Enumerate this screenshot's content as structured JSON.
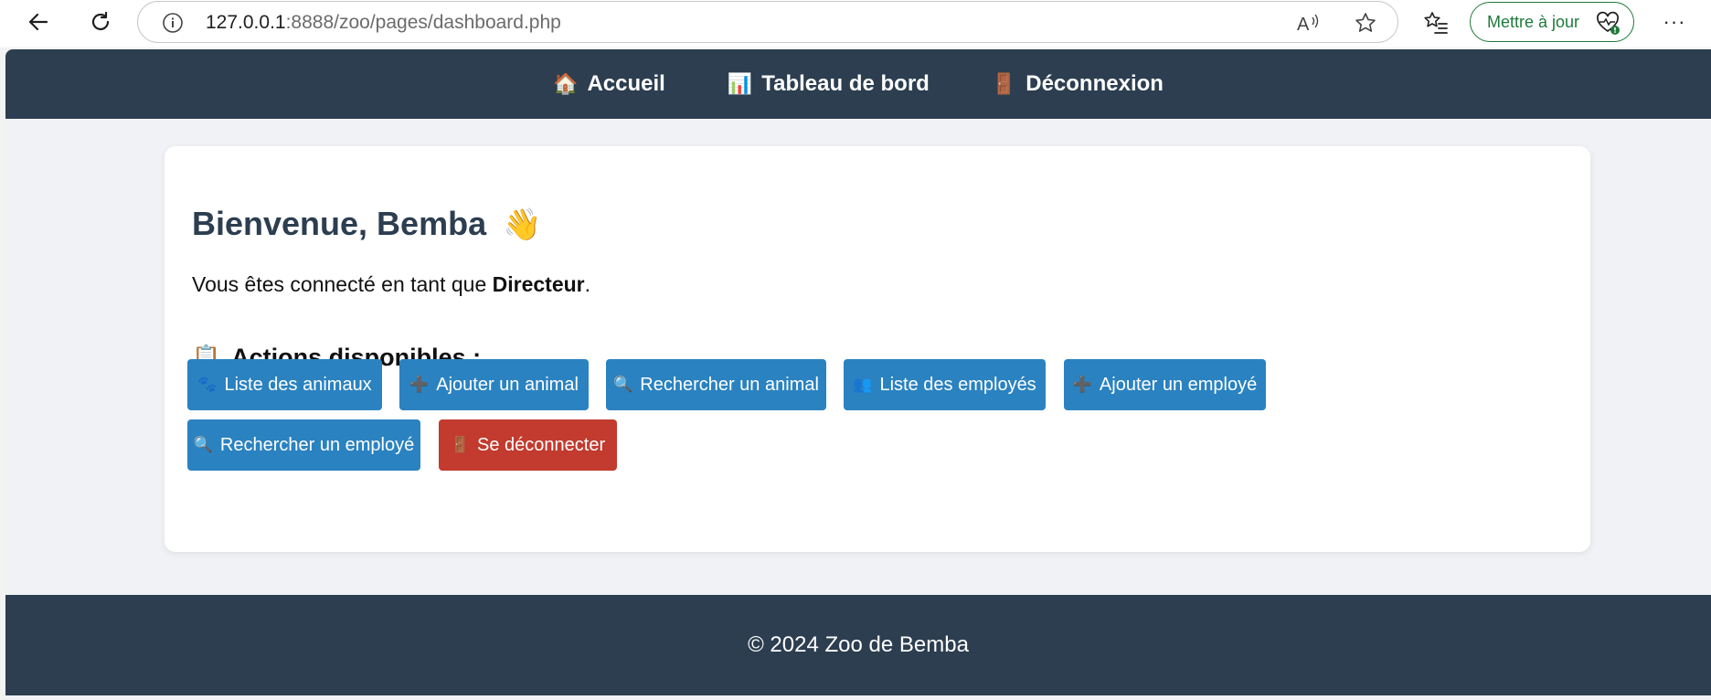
{
  "browser": {
    "url_host": "127.0.0.1",
    "url_rest": ":8888/zoo/pages/dashboard.php",
    "update_label": "Mettre à jour"
  },
  "nav": {
    "items": [
      {
        "icon": "🏠",
        "label": "Accueil"
      },
      {
        "icon": "📊",
        "label": "Tableau de bord"
      },
      {
        "icon": "🚪",
        "label": "Déconnexion"
      }
    ]
  },
  "main": {
    "welcome_text": "Bienvenue, Bemba",
    "welcome_icon": "👋",
    "role_prefix": "Vous êtes connecté en tant que ",
    "role_value": "Directeur",
    "role_suffix": ".",
    "actions_icon": "📋",
    "actions_title": "Actions disponibles :",
    "buttons": [
      {
        "icon": "🐾",
        "label": "Liste des animaux"
      },
      {
        "icon": "➕",
        "label": "Ajouter un animal"
      },
      {
        "icon": "🔍",
        "label": "Rechercher un animal"
      },
      {
        "icon": "👥",
        "label": "Liste des employés"
      },
      {
        "icon": "➕",
        "label": "Ajouter un employé"
      },
      {
        "icon": "🔍",
        "label": "Rechercher un employé"
      },
      {
        "icon": "🚪",
        "label": "Se déconnecter"
      }
    ]
  },
  "footer": {
    "text": "© 2024 Zoo de Bemba"
  },
  "colors": {
    "nav_bg": "#2c3e50",
    "primary_button": "#2a82c1",
    "danger_button": "#c23b2e",
    "page_bg": "#f0f2f5"
  }
}
